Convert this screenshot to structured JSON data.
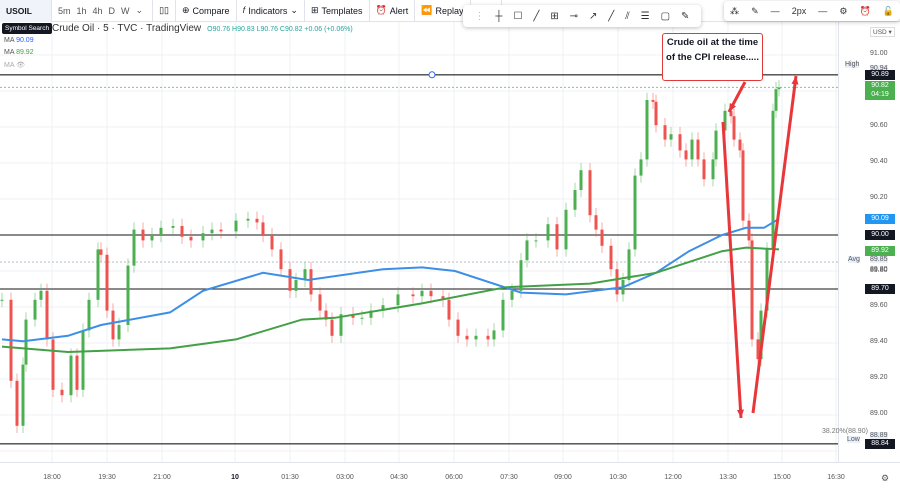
{
  "toolbar": {
    "symbol": "USOIL",
    "intervals": [
      "5m",
      "1h",
      "4h",
      "D",
      "W"
    ],
    "interval_dropdown": "⌄",
    "compare": "Compare",
    "indicators": "Indicators",
    "templates": "Templates",
    "alert": "Alert",
    "replay": "Replay",
    "undo": "↶",
    "redo": "↷"
  },
  "tooltip": "Symbol Search",
  "legend": {
    "title": "Crude Oil · 5 · TVC · TradingView",
    "ohlc": "O90.76 H90.83 L90.76 C90.82 +0.06 (+0.06%)",
    "ma1_label": "MA",
    "ma1_value": "90.09",
    "ma2_label": "MA",
    "ma2_value": "89.92",
    "ma3_label": "MA",
    "ma3_value": "👁"
  },
  "drawing_tools": [
    "⋮",
    "┼",
    "☐",
    "╱",
    "⊞",
    "⊸",
    "↗",
    "╱",
    "⫽",
    "☰",
    "▢",
    "✎"
  ],
  "right_tools": {
    "icons": [
      "⁂",
      "✎",
      "—",
      "2px",
      "—",
      "⚙",
      "⏰",
      "🔓"
    ],
    "currency": "USD ▾"
  },
  "annotation": "Crude oil at the time of the CPI release.....",
  "colors": {
    "up": "#4caf50",
    "down": "#ef5350",
    "ma_fast": "#3d8ee6",
    "ma_slow": "#43a047",
    "arrow": "#e8373a"
  },
  "chart_data": {
    "type": "candlestick",
    "symbol": "Crude Oil 5m",
    "ylim": [
      88.75,
      91.1
    ],
    "yticks": [
      "91.00",
      "90.60",
      "90.40",
      "90.20",
      "89.80",
      "89.60",
      "89.40",
      "89.20",
      "89.00"
    ],
    "xticks": [
      "18:00",
      "19:30",
      "21:00",
      "10",
      "01:30",
      "03:00",
      "04:30",
      "06:00",
      "07:30",
      "09:00",
      "10:30",
      "12:00",
      "13:30",
      "15:00",
      "16:30"
    ],
    "closes": [
      [
        0,
        89.64
      ],
      [
        3,
        89.19
      ],
      [
        5,
        88.94
      ],
      [
        7,
        89.28
      ],
      [
        8,
        89.53
      ],
      [
        11,
        89.64
      ],
      [
        13,
        89.69
      ],
      [
        15,
        89.42
      ],
      [
        17,
        89.14
      ],
      [
        20,
        89.11
      ],
      [
        23,
        89.33
      ],
      [
        25,
        89.14
      ],
      [
        27,
        89.47
      ],
      [
        29,
        89.64
      ],
      [
        32,
        89.92
      ],
      [
        33,
        89.89
      ],
      [
        35,
        89.58
      ],
      [
        37,
        89.42
      ],
      [
        39,
        89.5
      ],
      [
        42,
        89.83
      ],
      [
        44,
        90.03
      ],
      [
        47,
        89.97
      ],
      [
        50,
        90.0
      ],
      [
        53,
        90.04
      ],
      [
        57,
        90.05
      ],
      [
        60,
        89.99
      ],
      [
        63,
        89.97
      ],
      [
        67,
        90.01
      ],
      [
        70,
        90.03
      ],
      [
        73,
        90.02
      ],
      [
        78,
        90.08
      ],
      [
        82,
        90.09
      ],
      [
        85,
        90.07
      ],
      [
        87,
        90.0
      ],
      [
        90,
        89.92
      ],
      [
        93,
        89.81
      ],
      [
        96,
        89.69
      ],
      [
        98,
        89.75
      ],
      [
        101,
        89.81
      ],
      [
        103,
        89.67
      ],
      [
        106,
        89.58
      ],
      [
        108,
        89.53
      ],
      [
        110,
        89.44
      ],
      [
        113,
        89.56
      ],
      [
        117,
        89.54
      ],
      [
        120,
        89.54
      ],
      [
        123,
        89.58
      ],
      [
        127,
        89.61
      ],
      [
        132,
        89.67
      ],
      [
        137,
        89.66
      ],
      [
        140,
        89.69
      ],
      [
        143,
        89.66
      ],
      [
        147,
        89.64
      ],
      [
        149,
        89.53
      ],
      [
        152,
        89.44
      ],
      [
        155,
        89.42
      ],
      [
        158,
        89.44
      ],
      [
        162,
        89.42
      ],
      [
        164,
        89.47
      ],
      [
        167,
        89.64
      ],
      [
        170,
        89.69
      ],
      [
        173,
        89.86
      ],
      [
        175,
        89.97
      ],
      [
        178,
        89.97
      ],
      [
        182,
        90.06
      ],
      [
        185,
        89.92
      ],
      [
        188,
        90.14
      ],
      [
        191,
        90.25
      ],
      [
        193,
        90.36
      ],
      [
        196,
        90.11
      ],
      [
        198,
        90.03
      ],
      [
        200,
        89.94
      ],
      [
        203,
        89.81
      ],
      [
        205,
        89.67
      ],
      [
        207,
        89.75
      ],
      [
        209,
        89.92
      ],
      [
        211,
        90.33
      ],
      [
        213,
        90.42
      ],
      [
        215,
        90.75
      ],
      [
        217,
        90.74
      ],
      [
        218,
        90.61
      ],
      [
        221,
        90.53
      ],
      [
        223,
        90.56
      ],
      [
        226,
        90.47
      ],
      [
        228,
        90.42
      ],
      [
        230,
        90.53
      ],
      [
        232,
        90.42
      ],
      [
        234,
        90.31
      ],
      [
        237,
        90.42
      ],
      [
        238,
        90.58
      ],
      [
        241,
        90.69
      ],
      [
        243,
        90.66
      ],
      [
        244,
        90.53
      ],
      [
        246,
        90.47
      ],
      [
        247,
        90.08
      ],
      [
        249,
        89.97
      ],
      [
        250,
        89.42
      ],
      [
        252,
        89.31
      ],
      [
        253,
        89.58
      ],
      [
        255,
        89.92
      ],
      [
        257,
        90.69
      ],
      [
        258,
        90.81
      ],
      [
        259,
        90.82
      ]
    ],
    "ma_fast": [
      [
        0,
        89.42
      ],
      [
        7,
        89.41
      ],
      [
        22,
        89.44
      ],
      [
        33,
        89.5
      ],
      [
        56,
        89.57
      ],
      [
        67,
        89.69
      ],
      [
        87,
        89.79
      ],
      [
        102,
        89.75
      ],
      [
        127,
        89.81
      ],
      [
        140,
        89.82
      ],
      [
        151,
        89.8
      ],
      [
        173,
        89.68
      ],
      [
        188,
        89.67
      ],
      [
        207,
        89.71
      ],
      [
        218,
        89.79
      ],
      [
        229,
        89.91
      ],
      [
        240,
        90.0
      ],
      [
        248,
        90.04
      ],
      [
        254,
        90.04
      ],
      [
        259,
        90.09
      ]
    ],
    "ma_slow": [
      [
        0,
        89.38
      ],
      [
        22,
        89.35
      ],
      [
        56,
        89.37
      ],
      [
        78,
        89.42
      ],
      [
        100,
        89.53
      ],
      [
        111,
        89.54
      ],
      [
        140,
        89.62
      ],
      [
        168,
        89.71
      ],
      [
        196,
        89.73
      ],
      [
        218,
        89.79
      ],
      [
        240,
        89.91
      ],
      [
        248,
        89.93
      ],
      [
        259,
        89.92
      ]
    ],
    "hlines": [
      {
        "price": 90.89,
        "label": "90.89"
      },
      {
        "price": 90.0,
        "label": "90.00"
      },
      {
        "price": 89.7,
        "label": "89.70"
      },
      {
        "price": 88.84,
        "label": "88.84"
      }
    ],
    "price_labels": {
      "high_label": "High",
      "high": "90.94",
      "last": "90.82",
      "countdown": "04:19",
      "ma_fast": "90.09",
      "ma_fast_line": "90.00",
      "ma_slow": "89.92",
      "avg_label": "Avg",
      "avg": "89.85",
      "avg_tick": "89.80",
      "low_label": "Low",
      "low": "88.89",
      "fib": "38.20%(88.90)"
    }
  }
}
